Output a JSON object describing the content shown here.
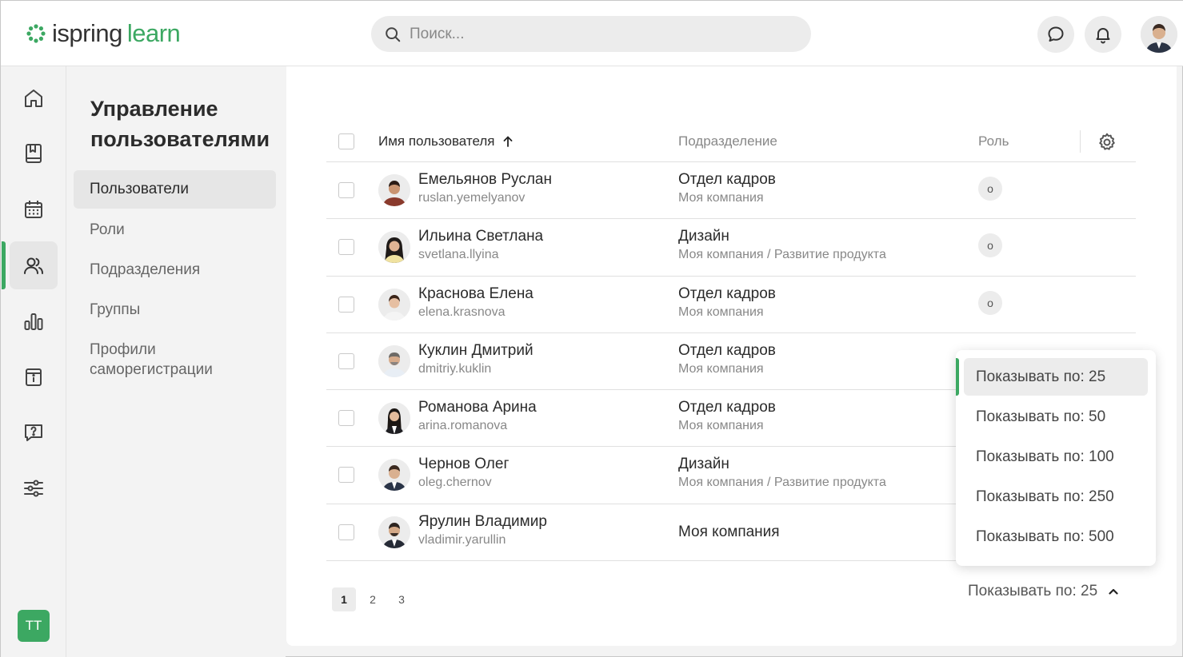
{
  "app": {
    "logo_left": "ispring",
    "logo_right": "learn",
    "brand_color": "#3ca862"
  },
  "search": {
    "placeholder": "Поиск..."
  },
  "header_icons": [
    "chat-icon",
    "bell-icon",
    "user-avatar"
  ],
  "rail": {
    "items": [
      "home-icon",
      "book-icon",
      "calendar-icon",
      "users-icon",
      "chart-icon",
      "info-icon",
      "question-icon",
      "sliders-icon"
    ],
    "active": "users-icon",
    "user_initials": "ТТ"
  },
  "sidebar": {
    "title": "Управление пользователями",
    "items": [
      {
        "label": "Пользователи",
        "active": true
      },
      {
        "label": "Роли"
      },
      {
        "label": "Подразделения"
      },
      {
        "label": "Группы"
      },
      {
        "label": "Профили саморегистрации"
      }
    ]
  },
  "table": {
    "columns": {
      "name": "Имя пользователя",
      "department": "Подразделение",
      "role": "Роль"
    },
    "rows": [
      {
        "name": "Емельянов Руслан",
        "login": "ruslan.yemelyanov",
        "department": "Отдел кадров",
        "path": "Моя компания",
        "role": "о"
      },
      {
        "name": "Ильина Светлана",
        "login": "svetlana.llyina",
        "department": "Дизайн",
        "path": "Моя компания / Развитие продукта",
        "role": "о"
      },
      {
        "name": "Краснова Елена",
        "login": "elena.krasnova",
        "department": "Отдел кадров",
        "path": "Моя компания",
        "role": "о"
      },
      {
        "name": "Куклин Дмитрий",
        "login": "dmitriy.kuklin",
        "department": "Отдел кадров",
        "path": "Моя компания",
        "role": ""
      },
      {
        "name": "Романова Арина",
        "login": "arina.romanova",
        "department": "Отдел кадров",
        "path": "Моя компания",
        "role": ""
      },
      {
        "name": "Чернов Олег",
        "login": "oleg.chernov",
        "department": "Дизайн",
        "path": "Моя компания / Развитие продукта",
        "role": ""
      },
      {
        "name": "Ярулин Владимир",
        "login": "vladimir.yarullin",
        "department": "Моя компания",
        "path": "",
        "role": ""
      }
    ]
  },
  "pagination": {
    "pages": [
      "1",
      "2",
      "3"
    ],
    "active": "1",
    "per_page_label": "Показывать по: 25"
  },
  "per_page_dropdown": {
    "options": [
      "Показывать по: 25",
      "Показывать по: 50",
      "Показывать по: 100",
      "Показывать по: 250",
      "Показывать по: 500"
    ],
    "selected": "Показывать по: 25"
  }
}
